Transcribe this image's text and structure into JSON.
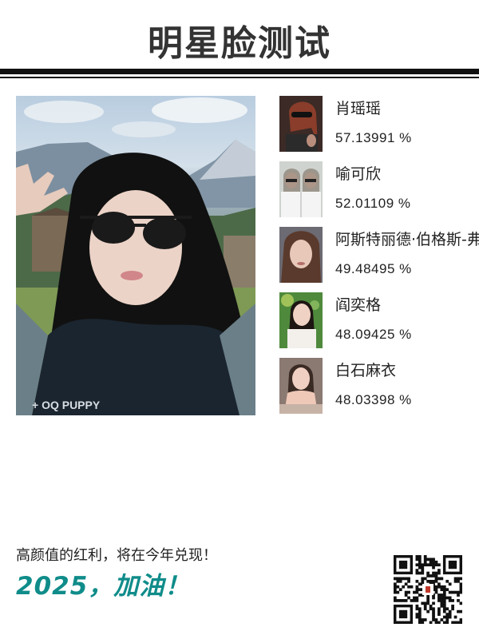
{
  "header": {
    "title": "明星脸测试"
  },
  "user_photo": {
    "alt": "user-selfie"
  },
  "matches": [
    {
      "name": "肖瑶瑶",
      "score": "57.13991 %"
    },
    {
      "name": "喻可欣",
      "score": "52.01109 %"
    },
    {
      "name": "阿斯特丽德·伯格斯-弗",
      "score": "49.48495 %"
    },
    {
      "name": "阎奕格",
      "score": "48.09425 %"
    },
    {
      "name": "白石麻衣",
      "score": "48.03398 %"
    }
  ],
  "footer": {
    "text": "高颜值的红利，将在今年兑现！",
    "slogan": "2025，加油！"
  },
  "colors": {
    "title": "#333333",
    "slogan": "#0f8c8a"
  }
}
